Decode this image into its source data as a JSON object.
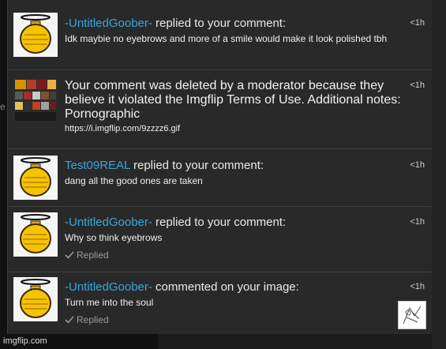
{
  "notifications": [
    {
      "user": "-UntitledGoober-",
      "action": " replied to your comment:",
      "body": "Idk maybie no eyebrows and more of a smile would make it look polished tbh",
      "time": "<1h"
    },
    {
      "message": "Your comment was deleted by a moderator because they believe it violated the Imgflip Terms of Use. Additional notes: Pornographic",
      "link": "https://i.imgflip.com/9zzzz6.gif",
      "time": "<1h"
    },
    {
      "user": "Test09REAL",
      "action": " replied to your comment:",
      "body": "dang all the good ones are taken",
      "time": "<1h"
    },
    {
      "user": "-UntitledGoober-",
      "action": " replied to your comment:",
      "body": "Why so think eyebrows",
      "replied": "Replied",
      "time": "<1h"
    },
    {
      "user": "-UntitledGoober-",
      "action": " commented on your image:",
      "body": "Turn me into the soul",
      "replied": "Replied",
      "time": "<1h"
    }
  ],
  "left_strip_char": "e",
  "watermark": "imgflip.com",
  "icons": {
    "avatar": "golden-jar-halo-icon",
    "check": "checkmark-icon",
    "thumb": "image-thumbnail"
  },
  "colors": {
    "username": "#3aa6dc",
    "panel": "#292929",
    "background": "#1b1b1b"
  }
}
